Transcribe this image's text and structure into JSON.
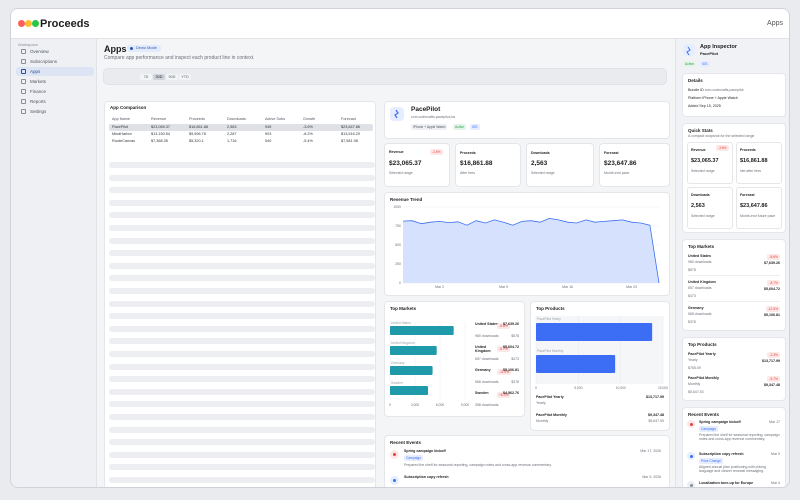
{
  "app": {
    "name": "Proceeds",
    "tag": "Apps"
  },
  "sidebar": {
    "section": "Workspace",
    "items": [
      {
        "label": "Overview"
      },
      {
        "label": "Subscriptions"
      },
      {
        "label": "Apps"
      },
      {
        "label": "Markets"
      },
      {
        "label": "Finance"
      },
      {
        "label": "Reports"
      },
      {
        "label": "Settings"
      }
    ]
  },
  "page": {
    "title": "Apps",
    "demo_badge": "Demo Mode",
    "subtitle": "Compare app performance and inspect each product line in context."
  },
  "ranges": [
    "7D",
    "30D",
    "90D",
    "YTD"
  ],
  "selected_range": "30D",
  "comparison": {
    "title": "App Comparison",
    "columns": [
      "App Name",
      "Revenue",
      "Proceeds",
      "Downloads",
      "Active Subs",
      "Growth",
      "Forecast"
    ],
    "rows": [
      [
        "PacePilot",
        "$23,065.37",
        "$16,861.88",
        "2,563",
        "945",
        "-3.6%",
        "$23,647.86"
      ],
      [
        "MindHarbor",
        "$13,150.54",
        "$9,596.78",
        "2,287",
        "903",
        "-8.2%",
        "$13,516.29"
      ],
      [
        "RouteCanvas",
        "$7,368.35",
        "$5,320.1",
        "1,716",
        "540",
        "-5.4%",
        "$7,581.98"
      ]
    ]
  },
  "detail": {
    "name": "PacePilot",
    "bundle": "com.codecrafts.pacepilot.ios",
    "platform": "iPhone + Apple Watch",
    "status": "Active",
    "sku": "iOS",
    "stats": [
      {
        "label": "Revenue",
        "value": "$23,065.37",
        "note": "Selected range",
        "delta": "-3.6%"
      },
      {
        "label": "Proceeds",
        "value": "$16,861.88",
        "note": "After fees"
      },
      {
        "label": "Downloads",
        "value": "2,563",
        "note": "Selected range"
      },
      {
        "label": "Forecast",
        "value": "$23,647.86",
        "note": "Month-end pace"
      }
    ]
  },
  "trend": {
    "title": "Revenue Trend"
  },
  "chart_data": [
    {
      "type": "area",
      "title": "Revenue Trend",
      "x": [
        "Feb 26",
        "Feb 27",
        "Feb 28",
        "Mar 1",
        "Mar 2",
        "Mar 3",
        "Mar 4",
        "Mar 5",
        "Mar 6",
        "Mar 7",
        "Mar 8",
        "Mar 9",
        "Mar 10",
        "Mar 11",
        "Mar 12",
        "Mar 13",
        "Mar 14",
        "Mar 15",
        "Mar 16",
        "Mar 17",
        "Mar 18",
        "Mar 19",
        "Mar 20",
        "Mar 21",
        "Mar 22",
        "Mar 23",
        "Mar 24",
        "Mar 25",
        "Mar 26"
      ],
      "x_ticks": [
        "Mar 2",
        "Mar 9",
        "Mar 16",
        "Mar 23"
      ],
      "y": [
        815,
        820,
        780,
        800,
        810,
        795,
        805,
        760,
        820,
        790,
        830,
        800,
        760,
        810,
        820,
        800,
        850,
        830,
        800,
        790,
        830,
        800,
        810,
        820,
        830,
        800,
        790,
        760,
        0
      ],
      "ylim": [
        0,
        1000
      ],
      "yticks": [
        0,
        250,
        500,
        750,
        1000
      ]
    },
    {
      "type": "bar",
      "title": "Top Markets",
      "orientation": "horizontal",
      "categories": [
        "United States",
        "United Kingdom",
        "Germany",
        "Sweden"
      ],
      "values": [
        7639,
        5604,
        5107,
        4563
      ],
      "xlim": [
        0,
        9000
      ],
      "xticks": [
        0,
        3000,
        6000,
        9000
      ]
    },
    {
      "type": "bar",
      "title": "Top Products",
      "orientation": "horizontal",
      "categories": [
        "PacePilot Yearly",
        "PacePilot Monthly"
      ],
      "values": [
        13717.99,
        9347.48
      ],
      "xlim": [
        0,
        15000
      ],
      "xticks": [
        0,
        5000,
        10000,
        15000
      ]
    }
  ],
  "markets": {
    "title": "Top Markets",
    "items": [
      {
        "name": "United States",
        "value": "$7,639.26",
        "downloads": "980 downloads",
        "delta": "-8.6%",
        "sub": "$578"
      },
      {
        "name": "United Kingdom",
        "value": "$5,604.72",
        "downloads": "657 downloads",
        "delta": "-8.7%",
        "sub": "$473"
      },
      {
        "name": "Germany",
        "value": "$5,106.81",
        "downloads": "568 downloads",
        "delta": "-11.5%",
        "sub": "$378"
      },
      {
        "name": "Sweden",
        "value": "$4,562.76",
        "downloads": "358 downloads",
        "delta": "+8.3%",
        "sub": ""
      }
    ]
  },
  "products": {
    "title": "Top Products",
    "items": [
      {
        "name": "PacePilot Yearly",
        "value": "$13,717.99",
        "period": "Yearly",
        "sub": ""
      },
      {
        "name": "PacePilot Monthly",
        "value": "$9,347.48",
        "period": "Monthly",
        "sub": "$5,647.53"
      }
    ]
  },
  "events": {
    "title": "Recent Events",
    "items": [
      {
        "title": "Spring campaign kickoff",
        "date": "Mar 17, 2026",
        "tag": "Campaign",
        "desc": "Prepared the shelf for seasonal reporting, campaign notes and cross-app revenue commentary."
      },
      {
        "title": "Subscription copy refresh",
        "date": "Mar 9, 2026",
        "tag": "Price Change",
        "desc": "Aligned annual plan positioning with pricing language and clearer renewal messaging."
      },
      {
        "title": "Localization tune-up for Europe",
        "date": "Mar 4",
        "tag": "",
        "desc": ""
      }
    ]
  },
  "inspector": {
    "title": "App Inspector",
    "app": "PacePilot",
    "status": "Active",
    "sku": "iOS",
    "details_title": "Details",
    "bundle_label": "Bundle ID",
    "bundle": "com.codecrafts.pacepilot",
    "platform_label": "Platform",
    "platform": "iPhone + Apple Watch",
    "added_label": "Added",
    "added": "Sep 15, 2025",
    "quick_title": "Quick Stats",
    "quick_sub": "A compact snapshot for the selected range",
    "quick": [
      {
        "label": "Revenue",
        "value": "$23,065.37",
        "note": "Selected range",
        "delta": "-3.6%"
      },
      {
        "label": "Proceeds",
        "value": "$16,861.88",
        "note": "Net after fees"
      },
      {
        "label": "Downloads",
        "value": "2,563",
        "note": "Selected range"
      },
      {
        "label": "Forecast",
        "value": "$23,647.86",
        "note": "Month-end future pace"
      }
    ],
    "markets_title": "Top Markets",
    "markets": [
      {
        "name": "United States",
        "sub": "980 downloads",
        "value": "$7,639.26",
        "delta": "-8.6%",
        "extra": "$578"
      },
      {
        "name": "United Kingdom",
        "sub": "657 downloads",
        "value": "$5,604.72",
        "delta": "-8.7%",
        "extra": "$473"
      },
      {
        "name": "Germany",
        "sub": "568 downloads",
        "value": "$5,106.81",
        "delta": "-11.5%",
        "extra": "$378"
      }
    ],
    "products_title": "Top Products",
    "products": [
      {
        "name": "PacePilot Yearly",
        "sub": "Yearly",
        "value": "$13,717.99",
        "delta": "-2.3%",
        "extra": "$765.09"
      },
      {
        "name": "PacePilot Monthly",
        "sub": "Monthly",
        "value": "$9,347.48",
        "delta": "-5.7%",
        "extra": "$5,647.53"
      }
    ],
    "events_title": "Recent Events",
    "events": [
      {
        "title": "Spring campaign kickoff",
        "date": "Mar 17",
        "tag": "Campaign",
        "desc": "Prepared the shelf for seasonal reporting, campaign notes and cross-app revenue commentary."
      },
      {
        "title": "Subscription copy refresh",
        "date": "Mar 9",
        "tag": "Price Change",
        "desc": "Aligned annual plan positioning with pricing language and clearer renewal messaging."
      },
      {
        "title": "Localization tune-up for Europe",
        "date": "Mar 4",
        "tag": "",
        "desc": ""
      }
    ]
  },
  "colors": {
    "accent": "#3b6ef5",
    "teal": "#1f9aab",
    "negative": "#e0443e",
    "positive": "#2e9e4f"
  }
}
